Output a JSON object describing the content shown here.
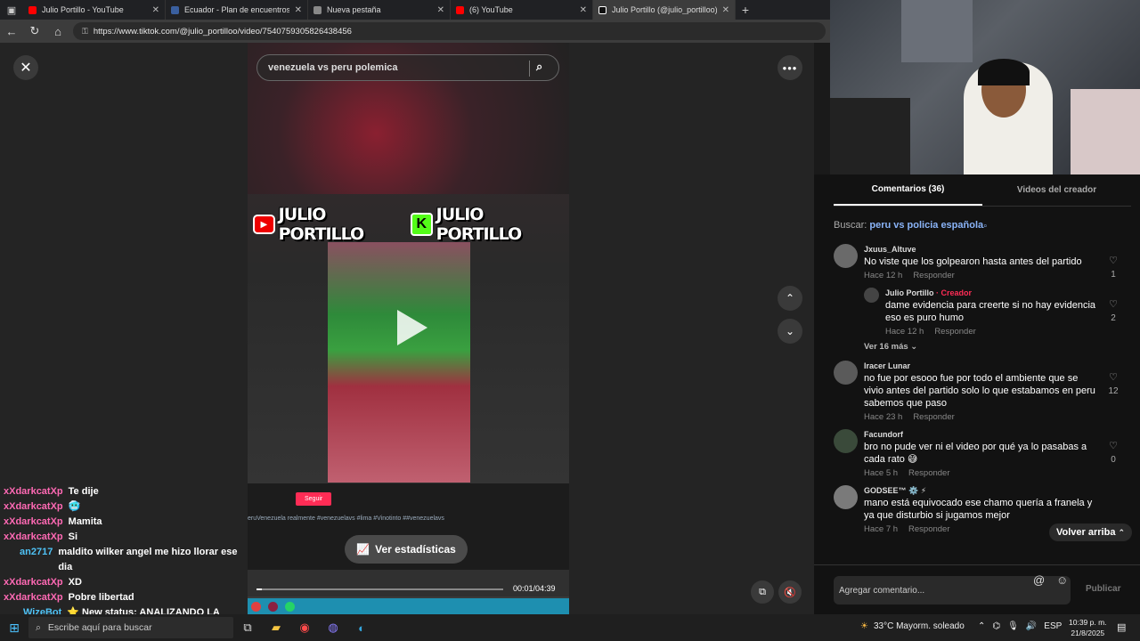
{
  "browser": {
    "tabs": [
      {
        "title": "Julio Portillo - YouTube",
        "icon_color": "#ff0000",
        "active": false
      },
      {
        "title": "Ecuador - Plan de encuentros 20",
        "icon_color": "#3a5f9f",
        "active": false
      },
      {
        "title": "Nueva pestaña",
        "icon_color": "#888888",
        "active": false
      },
      {
        "title": "(6) YouTube",
        "icon_color": "#ff0000",
        "active": false
      },
      {
        "title": "Julio Portillo (@julio_portilloo) | T",
        "icon_color": "#111111",
        "active": true
      }
    ],
    "url": "https://www.tiktok.com/@julio_portilloo/video/7540759305826438456"
  },
  "video": {
    "search_text": "venezuela vs peru polemica",
    "banner_text_1": "JULIO PORTILLO",
    "banner_text_2": "JULIO PORTILLO",
    "follow_label": "Seguir",
    "desc_line": "eruVenezuela realmente #venezuelavs #lima #Vinotinto ##venezuelavs",
    "stats_label": "Ver estadísticas",
    "time": "00:01/04:39",
    "progress": 0.004
  },
  "chat": [
    {
      "user": "xXdarkcatXp",
      "msg": "Te dije",
      "alt": false
    },
    {
      "user": "xXdarkcatXp",
      "msg": "🥶",
      "alt": false
    },
    {
      "user": "xXdarkcatXp",
      "msg": "Mamita",
      "alt": false
    },
    {
      "user": "xXdarkcatXp",
      "msg": "Si",
      "alt": false
    },
    {
      "user": "an2717",
      "msg": "maldito wilker angel me hizo llorar ese dia",
      "alt": true
    },
    {
      "user": "xXdarkcatXp",
      "msg": "XD",
      "alt": false
    },
    {
      "user": "xXdarkcatXp",
      "msg": "Pobre libertad",
      "alt": false
    },
    {
      "user": "WizeBot",
      "msg": "⭐ New status: ANALIZANDO LA",
      "alt": true
    }
  ],
  "panel": {
    "tab_comments": "Comentarios (36)",
    "tab_videos": "Videos del creador",
    "buscar_label": "Buscar:",
    "buscar_term": "peru vs policia española",
    "comments": [
      {
        "user": "Jxuus_Altuve",
        "creator": "",
        "text": "No viste que los golpearon hasta antes del partido",
        "time": "Hace 12 h",
        "reply": "Responder",
        "likes": "1",
        "is_reply": false
      },
      {
        "user": "Julio Portillo",
        "creator": " · Creador",
        "text": "dame evidencia para creerte si no hay evidencia eso es puro humo",
        "time": "Hace 12 h",
        "reply": "Responder",
        "likes": "2",
        "is_reply": true
      },
      {
        "user": "Iracer Lunar",
        "creator": "",
        "text": "no fue por esooo fue por todo el ambiente que se vivio antes del partido solo lo que estabamos en peru sabemos que paso",
        "time": "Hace 23 h",
        "reply": "Responder",
        "likes": "12",
        "is_reply": false
      },
      {
        "user": "Facundorf",
        "creator": "",
        "text": "bro no pude ver ni el video por qué ya lo pasabas a cada rato 😅",
        "time": "Hace 5 h",
        "reply": "Responder",
        "likes": "0",
        "is_reply": false
      },
      {
        "user": "GODSEE™ ⚙️ ⚡",
        "creator": "",
        "text": "mano está equivocado ese chamo quería a franela y ya que disturbio si jugamos mejor",
        "time": "Hace 7 h",
        "reply": "Responder",
        "likes": "",
        "is_reply": false
      }
    ],
    "ver_mas": "Ver 16 más",
    "volver": "Volver arriba",
    "add_placeholder": "Agregar comentario...",
    "publicar": "Publicar"
  },
  "taskbar": {
    "search_placeholder": "Escribe aquí para buscar",
    "weather": "33°C  Mayorm. soleado",
    "lang": "ESP",
    "time": "10:39 p. m.",
    "date": "21/8/2025"
  }
}
